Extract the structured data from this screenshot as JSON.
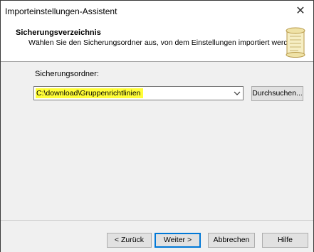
{
  "window": {
    "title": "Importeinstellungen-Assistent",
    "close_glyph": "✕"
  },
  "header": {
    "title": "Sicherungsverzeichnis",
    "subtitle": "Wählen Sie den Sicherungsordner aus, von dem Einstellungen importiert werden.",
    "icon": "scroll-icon"
  },
  "content": {
    "folder_label": "Sicherungsordner:",
    "folder_value": "C:\\download\\Gruppenrichtlinien",
    "browse_label": "Durchsuchen..."
  },
  "footer": {
    "back_label": "< Zurück",
    "next_label": "Weiter >",
    "cancel_label": "Abbrechen",
    "help_label": "Hilfe"
  },
  "colors": {
    "highlight": "#fffd38",
    "default_button_border": "#0078d7"
  }
}
